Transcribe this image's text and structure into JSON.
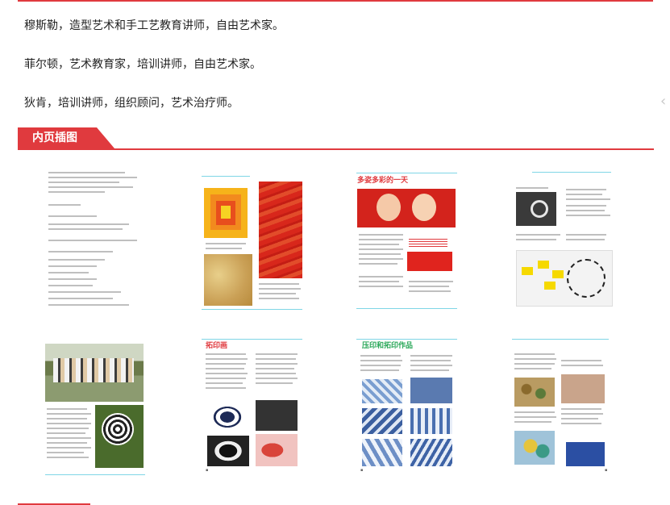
{
  "lines": [
    "穆斯勒，造型艺术和手工艺教育讲师，自由艺术家。",
    "菲尔顿，艺术教育家，培训讲师，自由艺术家。",
    "狄肯，培训讲师，组织顾问，艺术治疗师。"
  ],
  "section": {
    "title": "内页插图"
  },
  "thumbs": [
    {
      "id": "copyright-page"
    },
    {
      "id": "color-squares-page"
    },
    {
      "id": "colorful-day-page",
      "title": "多姿多彩的一天"
    },
    {
      "id": "collage-page"
    },
    {
      "id": "outdoor-art-page"
    },
    {
      "id": "print-page",
      "title": "拓印画"
    },
    {
      "id": "stamp-print-page",
      "title": "压印和拓印作品"
    },
    {
      "id": "handprint-page"
    }
  ],
  "colors": {
    "accent": "#e03a3e",
    "rule_blue": "#7fd6e6"
  }
}
